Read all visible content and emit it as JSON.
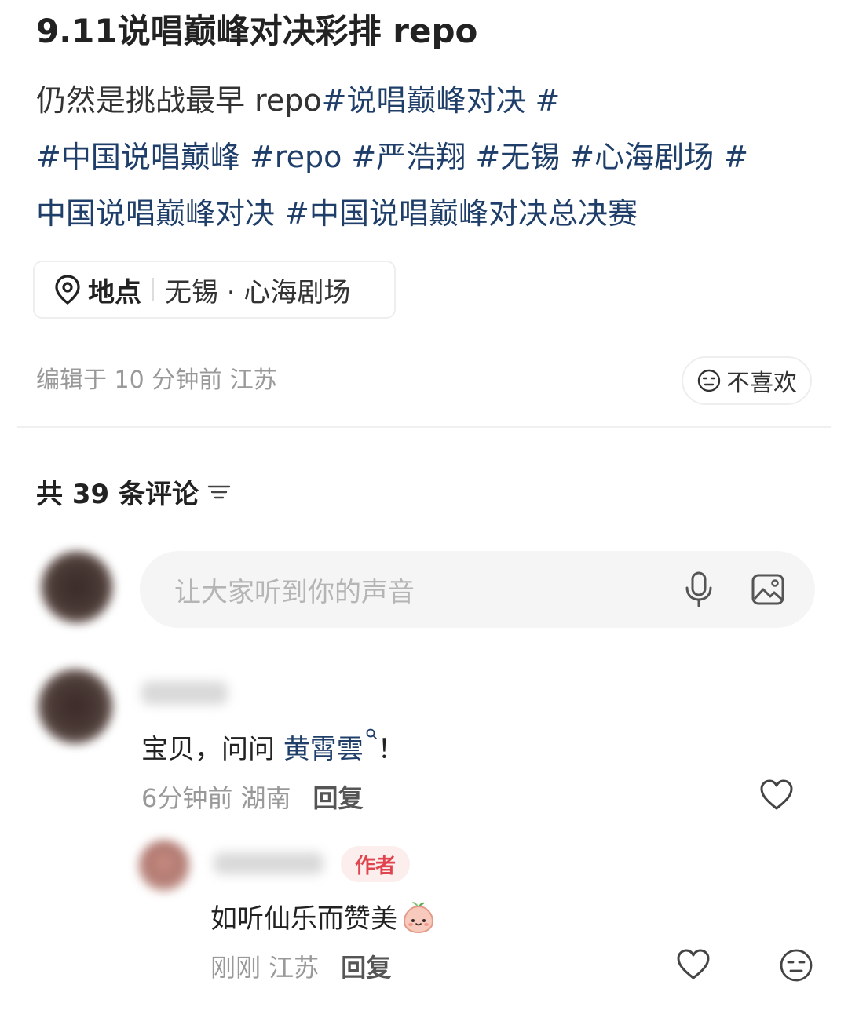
{
  "post": {
    "title": "9.11说唱巅峰对决彩排 repo",
    "description_prefix": "仍然是挑战最早 repo",
    "hashtags": [
      "#说唱巅峰对决 #",
      "#中国说唱巅峰",
      "#repo",
      "#严浩翔",
      "#无锡",
      "#心海剧场 #",
      "中国说唱巅峰对决",
      "#中国说唱巅峰对决总决赛"
    ],
    "location_label": "地点",
    "location_value": "无锡 · 心海剧场",
    "edited_meta": "编辑于 10 分钟前 江苏",
    "dislike_label": "不喜欢"
  },
  "comments_section": {
    "header": "共 39 条评论",
    "input_placeholder": "让大家听到你的声音"
  },
  "comments": [
    {
      "text_prefix": "宝贝，问问 ",
      "mention": "黄霄雲",
      "text_suffix": "！",
      "time": "6分钟前 湖南",
      "reply_label": "回复"
    }
  ],
  "reply": {
    "badge": "作者",
    "text": "如听仙乐而赞美",
    "time": "刚刚 江苏",
    "reply_label": "回复"
  },
  "colors": {
    "hashtag": "#1f3f6a",
    "author_badge_bg": "#fdeeee",
    "author_badge_text": "#e0454f"
  }
}
